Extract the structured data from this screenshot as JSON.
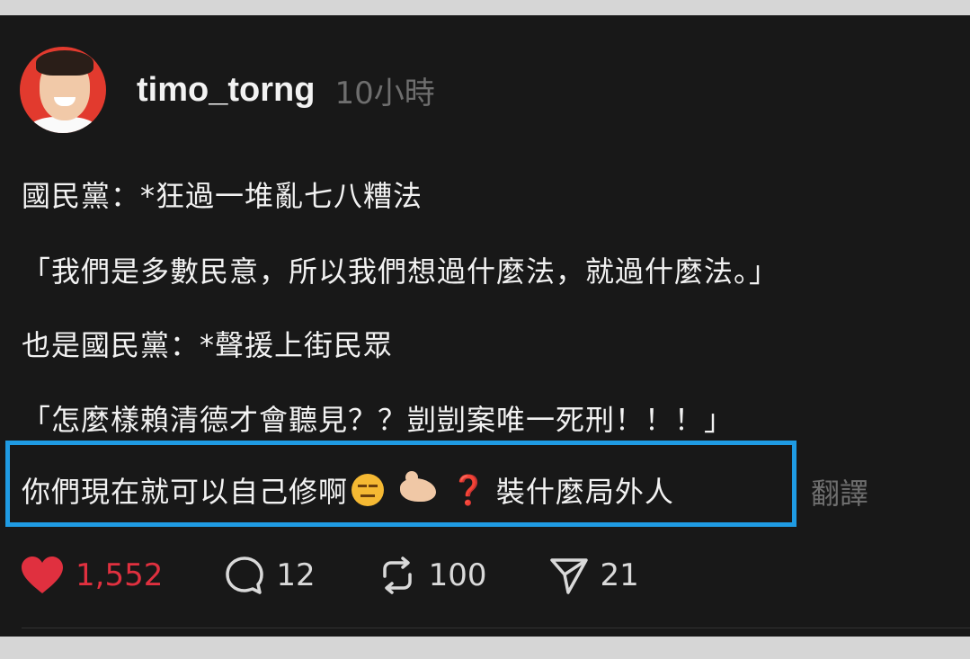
{
  "post": {
    "username": "timo_torng",
    "time": "10小時",
    "lines": [
      "國民黨：*狂過一堆亂七八糟法",
      "「我們是多數民意，所以我們想過什麼法，就過什麼法。」",
      "也是國民黨：*聲援上街民眾",
      "「怎麼樣賴清德才會聽見？？剴剴案唯一死刑！！！」"
    ],
    "highlighted": {
      "text_before": "你們現在就可以自己修啊",
      "emojis": [
        "expressionless-face",
        "pinching-hand",
        "red-question-mark"
      ],
      "question_mark": "❓",
      "text_after": "裝什麼局外人"
    },
    "translate_label": "翻譯",
    "highlight_color": "#1f9be3"
  },
  "actions": {
    "likes": "1,552",
    "comments": "12",
    "reposts": "100",
    "shares": "21",
    "like_color": "#e0303f"
  }
}
